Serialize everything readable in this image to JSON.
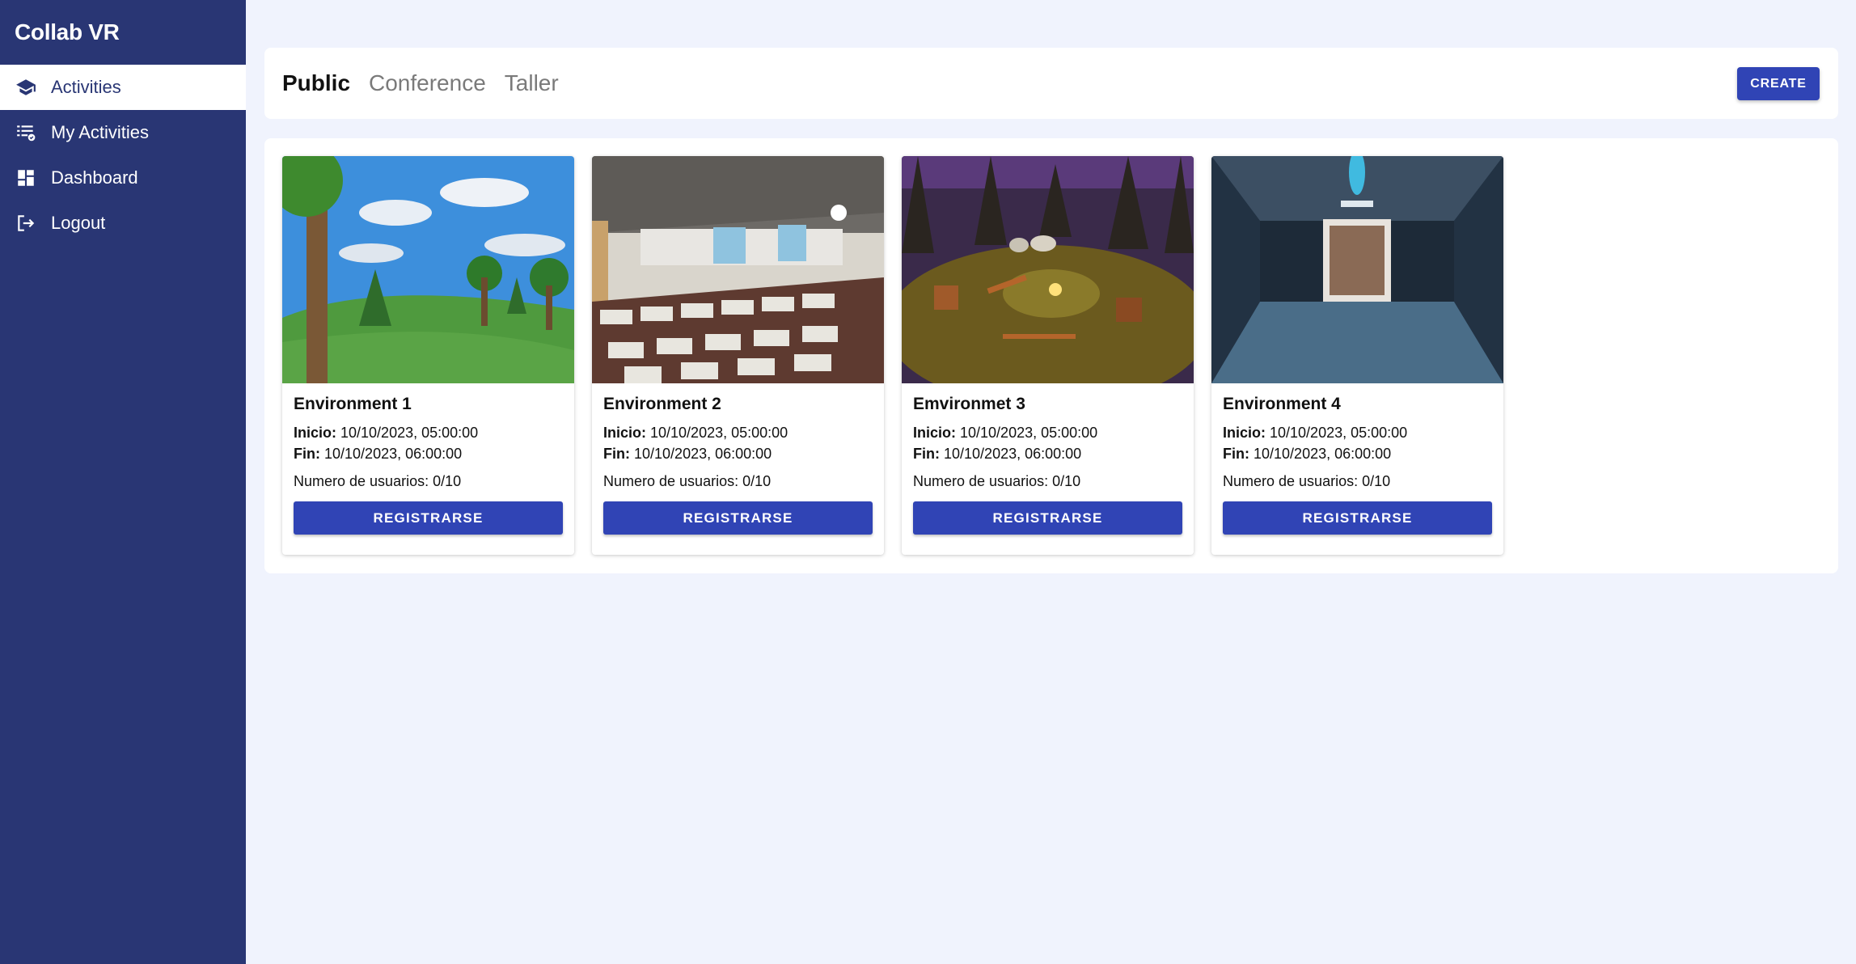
{
  "app": {
    "title": "Collab VR"
  },
  "sidebar": {
    "items": [
      {
        "label": "Activities",
        "icon": "graduation-cap-icon"
      },
      {
        "label": "My Activities",
        "icon": "checklist-icon"
      },
      {
        "label": "Dashboard",
        "icon": "dashboard-icon"
      },
      {
        "label": "Logout",
        "icon": "logout-icon"
      }
    ]
  },
  "tabs": [
    {
      "label": "Public"
    },
    {
      "label": "Conference"
    },
    {
      "label": "Taller"
    }
  ],
  "toolbar": {
    "create_label": "CREATE"
  },
  "labels": {
    "inicio": "Inicio:",
    "fin": "Fin:"
  },
  "cards": [
    {
      "title": "Environment 1",
      "inicio": "10/10/2023, 05:00:00",
      "fin": "10/10/2023, 06:00:00",
      "users": "Numero de usuarios: 0/10",
      "button": "REGISTRARSE"
    },
    {
      "title": "Environment 2",
      "inicio": "10/10/2023, 05:00:00",
      "fin": "10/10/2023, 06:00:00",
      "users": "Numero de usuarios: 0/10",
      "button": "REGISTRARSE"
    },
    {
      "title": "Emvironmet 3",
      "inicio": "10/10/2023, 05:00:00",
      "fin": "10/10/2023, 06:00:00",
      "users": "Numero de usuarios: 0/10",
      "button": "REGISTRARSE"
    },
    {
      "title": "Environment 4",
      "inicio": "10/10/2023, 05:00:00",
      "fin": "10/10/2023, 06:00:00",
      "users": "Numero de usuarios: 0/10",
      "button": "REGISTRARSE"
    }
  ],
  "colors": {
    "sidebar": "#293674",
    "accent": "#3044b5",
    "background": "#f0f3fd"
  }
}
